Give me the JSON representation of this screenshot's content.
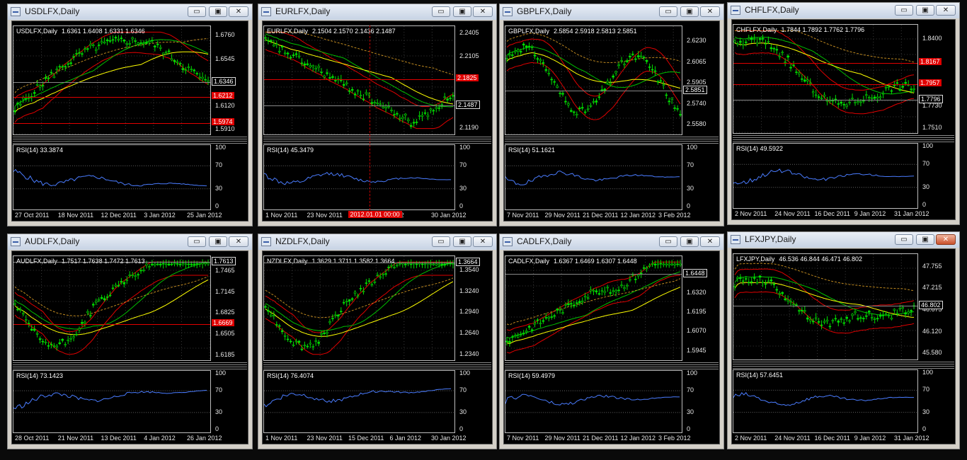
{
  "windows": [
    {
      "id": "usd",
      "title": "USDLFX,Daily",
      "win": {
        "l": 10,
        "t": 5,
        "w": 347,
        "h": 315
      },
      "price": {
        "symbol": "USDLFX,Daily",
        "values": "1.6361 1.6408 1.6331 1.6346",
        "min": 1.586,
        "max": 1.685,
        "ticks": [
          "1.6760",
          "1.6545",
          "1.6330",
          "1.6120",
          "1.5910"
        ],
        "current": "1.6346",
        "lines": [
          "1.6212",
          "1.5974"
        ]
      },
      "rsi": {
        "label": "RSI(14) 33.3874",
        "value": 33.3874
      },
      "xlabels": [
        "27 Oct 2011",
        "18 Nov 2011",
        "12 Dec 2011",
        "3 Jan 2012",
        "25 Jan 2012"
      ],
      "pattern": "bump",
      "close_hot": false
    },
    {
      "id": "eur",
      "title": "EURLFX,Daily",
      "win": {
        "l": 364,
        "t": 5,
        "w": 338,
        "h": 315
      },
      "price": {
        "symbol": "EURLFX,Daily",
        "values": "2.1504 2.1570 2.1436 2.1487",
        "min": 2.11,
        "max": 2.25,
        "ticks": [
          "2.2405",
          "2.2105",
          "2.1825",
          "2.1487",
          "2.1190"
        ],
        "current": "2.1487",
        "lines": [
          "2.1825"
        ]
      },
      "rsi": {
        "label": "RSI(14) 45.3479",
        "value": 45.3479
      },
      "xlabels": [
        "1 Nov 2011",
        "23 Nov 2011",
        "",
        "2012",
        "30 Jan 2012"
      ],
      "crosshair": "2012.01.01 00:00",
      "pattern": "drop",
      "close_hot": false
    },
    {
      "id": "gbp",
      "title": "GBPLFX,Daily",
      "win": {
        "l": 705,
        "t": 5,
        "w": 318,
        "h": 315
      },
      "price": {
        "symbol": "GBPLFX,Daily",
        "values": "2.5854 2.5918 2.5813 2.5851",
        "min": 2.55,
        "max": 2.635,
        "ticks": [
          "2.6230",
          "2.6065",
          "2.5905",
          "2.5740",
          "2.5580"
        ],
        "current": "2.5851",
        "lines": []
      },
      "rsi": {
        "label": "RSI(14) 51.1621",
        "value": 51.1621
      },
      "xlabels": [
        "7 Nov 2011",
        "29 Nov 2011",
        "21 Dec 2011",
        "12 Jan 2012",
        "3 Feb 2012"
      ],
      "pattern": "wave",
      "close_hot": false
    },
    {
      "id": "chf",
      "title": "CHFLFX,Daily",
      "win": {
        "l": 1027,
        "t": 3,
        "w": 329,
        "h": 315
      },
      "price": {
        "symbol": "CHFLFX,Daily",
        "values": "1.7844 1.7892 1.7762 1.7796",
        "min": 1.745,
        "max": 1.855,
        "ticks": [
          "1.8400",
          "1.7730",
          "1.7510"
        ],
        "current": "1.7796",
        "lines": [
          "1.8167",
          "1.7957"
        ]
      },
      "rsi": {
        "label": "RSI(14) 49.5922",
        "value": 49.5922
      },
      "xlabels": [
        "2 Nov 2011",
        "24 Nov 2011",
        "16 Dec 2011",
        "9 Jan 2012",
        "31 Jan 2012"
      ],
      "pattern": "fall",
      "close_hot": false
    },
    {
      "id": "aud",
      "title": "AUDLFX,Daily",
      "win": {
        "l": 10,
        "t": 330,
        "w": 347,
        "h": 305
      },
      "price": {
        "symbol": "AUDLFX,Daily",
        "values": "1.7517 1.7638 1.7472 1.7613",
        "min": 1.61,
        "max": 1.77,
        "ticks": [
          "1.7465",
          "1.7145",
          "1.6825",
          "1.6505",
          "1.6185"
        ],
        "current": "1.7613",
        "lines": [
          "1.6669"
        ]
      },
      "rsi": {
        "label": "RSI(14) 73.1423",
        "value": 73.1423
      },
      "xlabels": [
        "28 Oct 2011",
        "21 Nov 2011",
        "13 Dec 2011",
        "4 Jan 2012",
        "26 Jan 2012"
      ],
      "pattern": "rise",
      "close_hot": false
    },
    {
      "id": "nzd",
      "title": "NZDLFX,Daily",
      "win": {
        "l": 364,
        "t": 330,
        "w": 338,
        "h": 305
      },
      "price": {
        "symbol": "NZDLFX,Daily",
        "values": "1.3629 1.3711 1.3582 1.3664",
        "min": 1.225,
        "max": 1.375,
        "ticks": [
          "1.3540",
          "1.3240",
          "1.2940",
          "1.2640",
          "1.2340"
        ],
        "current": "1.3664",
        "lines": []
      },
      "rsi": {
        "label": "RSI(14) 76.4074",
        "value": 76.4074
      },
      "xlabels": [
        "1 Nov 2011",
        "23 Nov 2011",
        "15 Dec 2011",
        "6 Jan 2012",
        "30 Jan 2012"
      ],
      "pattern": "rise",
      "close_hot": false
    },
    {
      "id": "cad",
      "title": "CADLFX,Daily",
      "win": {
        "l": 705,
        "t": 330,
        "w": 318,
        "h": 305
      },
      "price": {
        "symbol": "CADLFX,Daily",
        "values": "1.6367 1.6469 1.6307 1.6448",
        "min": 1.588,
        "max": 1.656,
        "ticks": [
          "1.6320",
          "1.6195",
          "1.6070",
          "1.5945"
        ],
        "current": "1.6448",
        "lines": []
      },
      "rsi": {
        "label": "RSI(14) 59.4979",
        "value": 59.4979
      },
      "xlabels": [
        "7 Nov 2011",
        "29 Nov 2011",
        "21 Dec 2011",
        "12 Jan 2012",
        "3 Feb 2012"
      ],
      "pattern": "climb",
      "close_hot": false
    },
    {
      "id": "jpy",
      "title": "LFXJPY,Daily",
      "win": {
        "l": 1027,
        "t": 327,
        "w": 329,
        "h": 308
      },
      "price": {
        "symbol": "LFXJPY,Daily",
        "values": "46.536 46.844 46.471 46.802",
        "min": 45.4,
        "max": 48.1,
        "ticks": [
          "47.755",
          "47.215",
          "46.675",
          "46.120",
          "45.580"
        ],
        "current": "46.802",
        "lines": []
      },
      "rsi": {
        "label": "RSI(14) 57.6451",
        "value": 57.6451
      },
      "xlabels": [
        "2 Nov 2011",
        "24 Nov 2011",
        "16 Dec 2011",
        "9 Jan 2012",
        "31 Jan 2012"
      ],
      "pattern": "vshape",
      "close_hot": true
    }
  ],
  "rsi_ticks": [
    "100",
    "70",
    "30",
    "0"
  ],
  "buttons": {
    "minimize": "▭",
    "maximize": "▣",
    "close": "✕"
  },
  "colors": {
    "candles": "#00e000",
    "ma_yellow": "#ffff00",
    "ma_green": "#00c000",
    "bands": "#e00000",
    "rsi": "#4a7cff",
    "hline": "#e00000"
  }
}
